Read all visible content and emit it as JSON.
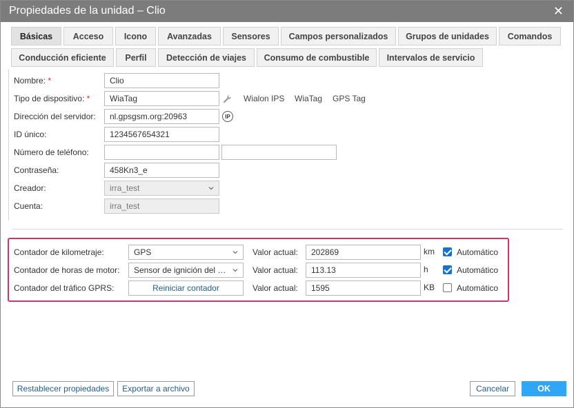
{
  "window": {
    "title": "Propiedades de la unidad – Clio",
    "close_glyph": "✕"
  },
  "tabs": [
    {
      "label": "Básicas"
    },
    {
      "label": "Acceso"
    },
    {
      "label": "Icono"
    },
    {
      "label": "Avanzadas"
    },
    {
      "label": "Sensores"
    },
    {
      "label": "Campos personalizados"
    },
    {
      "label": "Grupos de unidades"
    },
    {
      "label": "Comandos"
    },
    {
      "label": "Conducción eficiente"
    },
    {
      "label": "Perfil"
    },
    {
      "label": "Detección de viajes"
    },
    {
      "label": "Consumo de combustible"
    },
    {
      "label": "Intervalos de servicio"
    }
  ],
  "form": {
    "name": {
      "label": "Nombre:",
      "required": "*",
      "value": "Clio"
    },
    "device_type": {
      "label": "Tipo de dispositivo:",
      "required": "*",
      "value": "WiaTag",
      "options": [
        "Wialon IPS",
        "WiaTag",
        "GPS Tag"
      ]
    },
    "server_address": {
      "label": "Dirección del servidor:",
      "value": "nl.gpsgsm.org:20963",
      "ip_glyph": "IP"
    },
    "unique_id": {
      "label": "ID único:",
      "value": "1234567654321"
    },
    "phone": {
      "label": "Número de teléfono:",
      "value": "",
      "value2": ""
    },
    "password": {
      "label": "Contraseña:",
      "value": "458Kn3_e"
    },
    "creator": {
      "label": "Creador:",
      "value": "irra_test"
    },
    "account": {
      "label": "Cuenta:",
      "value": "irra_test"
    }
  },
  "counters": {
    "mileage": {
      "label": "Contador de kilometraje:",
      "select": "GPS",
      "current_label": "Valor actual:",
      "value": "202869",
      "unit": "km",
      "auto_label": "Automático",
      "auto": true
    },
    "engine_hours": {
      "label": "Contador de horas de motor:",
      "select": "Sensor de ignición del motor",
      "current_label": "Valor actual:",
      "value": "113.13",
      "unit": "h",
      "auto_label": "Automático",
      "auto": true
    },
    "gprs": {
      "label": "Contador del tráfico GPRS:",
      "reset_label": "Reiniciar contador",
      "current_label": "Valor actual:",
      "value": "1595",
      "unit": "KB",
      "auto_label": "Automático",
      "auto": false
    }
  },
  "footer": {
    "reset_props": "Restablecer propiedades",
    "export": "Exportar a archivo",
    "cancel": "Cancelar",
    "ok": "OK"
  },
  "colors": {
    "titlebar": "#7c7c7c",
    "highlight": "#d2326b",
    "ok_button": "#31a6f5",
    "link": "#1f5c8d",
    "checkbox": "#1a73c8"
  }
}
